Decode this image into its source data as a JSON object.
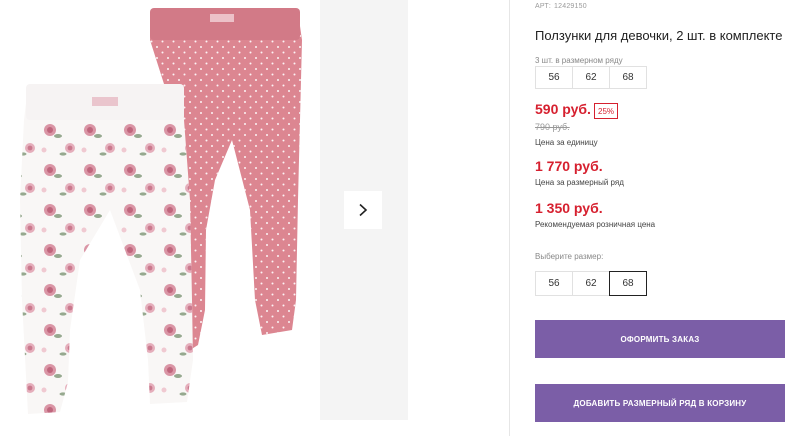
{
  "product": {
    "sku_label": "АРТ:",
    "sku_value": "12429150",
    "title": "Ползунки для девочки, 2 шт. в комплекте"
  },
  "size_set": {
    "label": "3 шт. в размерном ряду",
    "sizes": [
      "56",
      "62",
      "68"
    ]
  },
  "pricing": {
    "unit_price": "590 руб.",
    "discount": "25%",
    "old_price": "790 руб.",
    "unit_caption": "Цена за единицу",
    "set_price": "1 770 руб.",
    "set_caption": "Цена за размерный ряд",
    "rrp_price": "1 350 руб.",
    "rrp_caption": "Рекомендуемая розничная цена"
  },
  "size_choice": {
    "label": "Выберите размер:",
    "sizes": [
      "56",
      "62",
      "68"
    ],
    "selected": "68"
  },
  "buttons": {
    "order": "ОФОРМИТЬ ЗАКАЗ",
    "add_set": "ДОБАВИТЬ РАЗМЕРНЫЙ РЯД В КОРЗИНУ"
  },
  "gallery": {
    "next_icon": "chevron-right-icon",
    "colors": {
      "pink": "#dc8691",
      "white": "#f9f7f6",
      "rose": "#c56b82",
      "leaf": "#8ba083",
      "side_bg": "#f4f4f4"
    }
  },
  "theme": {
    "accent": "#7b5ea7",
    "price_red": "#d6202f"
  }
}
